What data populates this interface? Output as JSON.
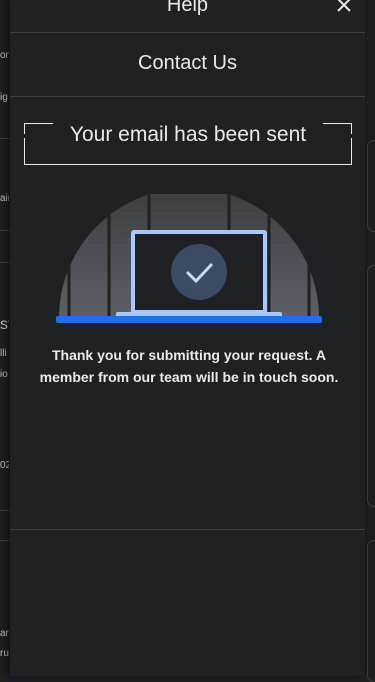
{
  "drawer": {
    "title": "Help",
    "subtitle": "Contact Us",
    "close_icon": "close-icon"
  },
  "confirmation": {
    "heading": "Your email has been sent",
    "message": "Thank you for submitting your request. A member from our team will be in touch soon.",
    "illustration_icon": "laptop-checkmark-icon"
  },
  "background_fragments": {
    "f1": "on",
    "f2": "ig",
    "f3": "air",
    "f4": "st",
    "f5": "lli",
    "f6": "io",
    "f7": "02",
    "f8": "ar",
    "f9": "ru"
  },
  "colors": {
    "drawer_bg": "#202124",
    "accent_blue": "#1a73e8",
    "laptop_frame": "#a8c7fa",
    "check_circle": "#3c4a63",
    "divider": "#3c4043"
  }
}
